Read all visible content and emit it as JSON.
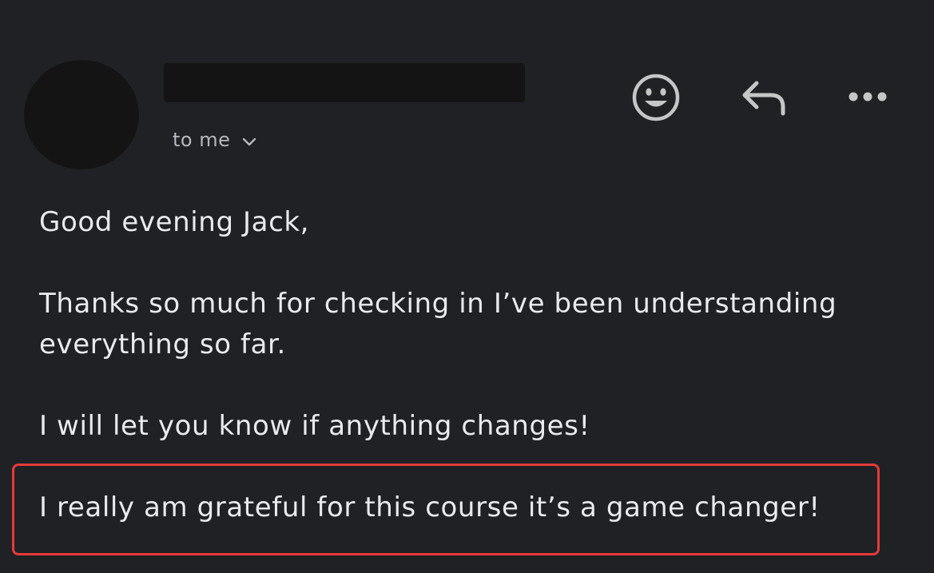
{
  "message": {
    "recipient_label": "to me",
    "body": {
      "greeting": "Good evening Jack,",
      "paragraph_1_line_1": "Thanks so much for checking in I’ve been understanding",
      "paragraph_1_line_2": "everything so far.",
      "paragraph_2": "I will let you know if anything changes!",
      "paragraph_3": "I really am grateful for this course it’s a game changer!"
    }
  },
  "actions": {
    "icons": [
      "emoji-reaction-icon",
      "reply-icon",
      "more-options-icon"
    ]
  },
  "colors": {
    "background": "#202124",
    "text": "#e8eaed",
    "muted_text": "#b5b8bd",
    "icon": "#c4c7c5",
    "redaction": "#141414",
    "highlight_border": "#e53a3a"
  }
}
